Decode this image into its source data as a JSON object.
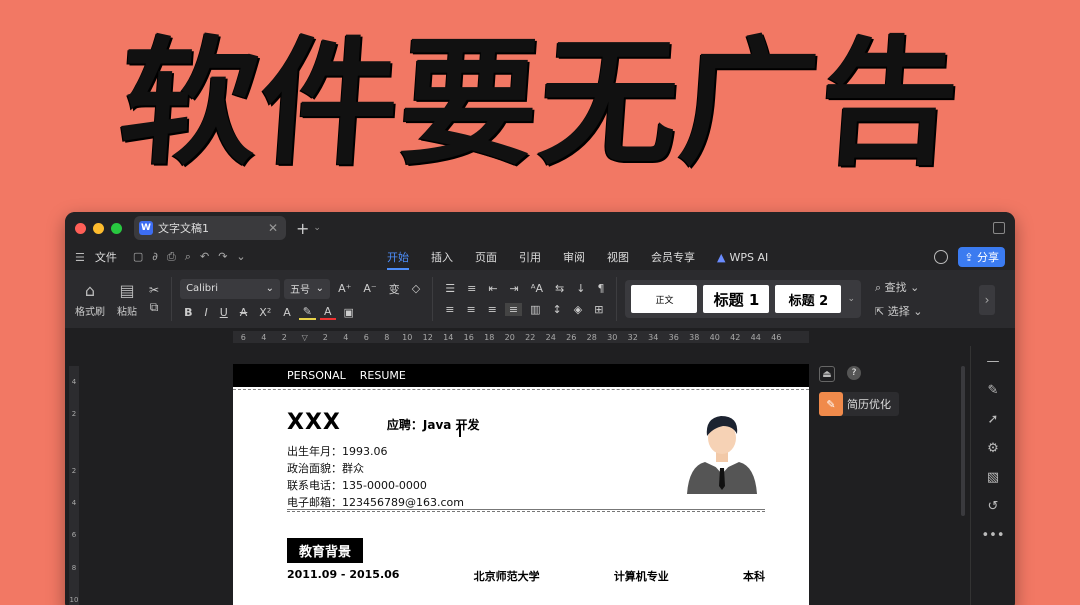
{
  "banner": {
    "text": "软件要无广告"
  },
  "titlebar": {
    "tab_title": "文字文稿1",
    "tab_icon_letter": "W",
    "traffic_colors": [
      "#ff5f57",
      "#febc2e",
      "#28c840"
    ]
  },
  "menubar": {
    "file_label": "文件",
    "tabs": [
      "开始",
      "插入",
      "页面",
      "引用",
      "审阅",
      "视图",
      "会员专享"
    ],
    "active_tab": "开始",
    "wps_ai_label": "WPS AI",
    "share_label": "分享"
  },
  "toolbar": {
    "format_painter": "格式刷",
    "paste": "粘贴",
    "font_name": "Calibri",
    "font_size": "五号",
    "style_normal": "正文",
    "style_h1": "标题 1",
    "style_h2": "标题 2",
    "find": "查找",
    "select": "选择"
  },
  "ruler": {
    "ticks": [
      "6",
      "4",
      "2",
      "",
      "2",
      "4",
      "6",
      "8",
      "10",
      "12",
      "14",
      "16",
      "18",
      "20",
      "22",
      "24",
      "26",
      "28",
      "30",
      "32",
      "34",
      "36",
      "38",
      "40",
      "42",
      "44",
      "46"
    ],
    "v_ticks": [
      "4",
      "2",
      "",
      "2",
      "4",
      "6",
      "8",
      "10"
    ]
  },
  "resume": {
    "header_left": "PERSONAL",
    "header_right": "RESUME",
    "name": "XXX",
    "job": "应聘：Java 开发",
    "birth": "出生年月：1993.06",
    "politics": "政治面貌：群众",
    "phone": "联系电话：135-0000-0000",
    "email": "电子邮箱：123456789@163.com",
    "section_edu": "教育背景",
    "edu_period": "2011.09 - 2015.06",
    "edu_school": "北京师范大学",
    "edu_major": "计算机专业",
    "edu_degree": "本科"
  },
  "side_panel": {
    "optimize_label": "简历优化"
  },
  "colors": {
    "accent_blue": "#4d8df8",
    "share_blue": "#3b7bf0",
    "banner_bg": "#f27864",
    "optimize_orange": "#f08a4b"
  }
}
